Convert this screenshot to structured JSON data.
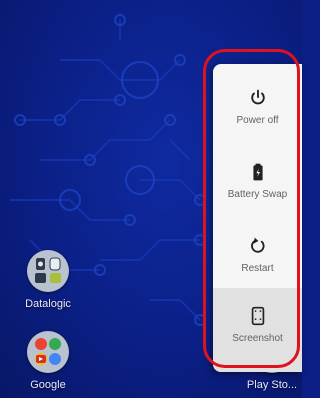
{
  "home": {
    "apps": [
      {
        "label": "Datalogic",
        "icon": "datalogic-folder-icon"
      },
      {
        "label": "Google",
        "icon": "google-folder-icon"
      },
      {
        "label": "Play Sto...",
        "icon": "play-store-icon"
      }
    ]
  },
  "power_menu": {
    "items": [
      {
        "label": "Power off",
        "icon": "power-icon"
      },
      {
        "label": "Battery Swap",
        "icon": "battery-icon"
      },
      {
        "label": "Restart",
        "icon": "restart-icon"
      },
      {
        "label": "Screenshot",
        "icon": "screenshot-icon"
      }
    ]
  },
  "colors": {
    "wallpaper": "#0b1f86",
    "menu_bg": "#f5f5f5",
    "highlight": "#e0121e"
  }
}
